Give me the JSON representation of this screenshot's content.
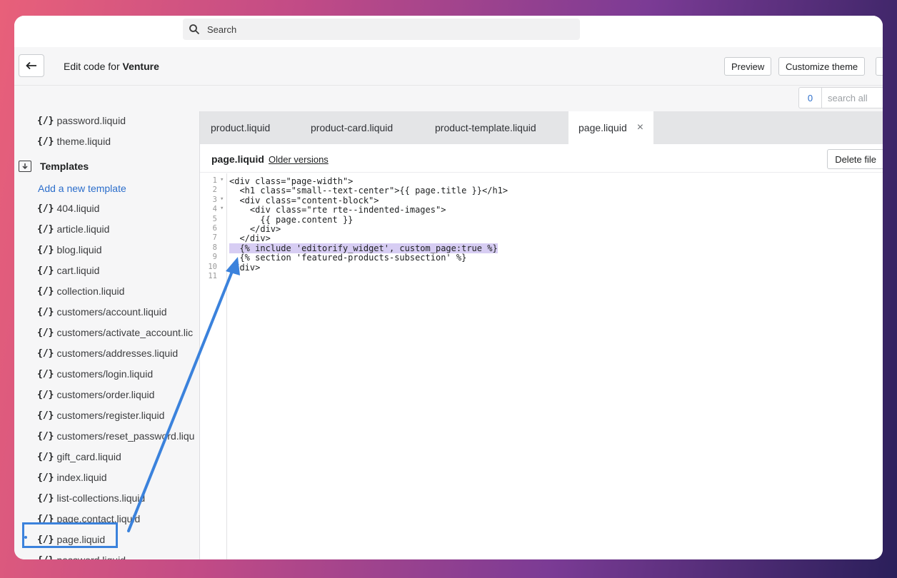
{
  "search": {
    "placeholder": "Search"
  },
  "header": {
    "title_prefix": "Edit code for ",
    "theme_name": "Venture",
    "buttons": {
      "preview": "Preview",
      "customize": "Customize theme"
    }
  },
  "file_search": {
    "count": "0",
    "placeholder": "search all"
  },
  "sidebar": {
    "top_items": [
      "password.liquid",
      "theme.liquid"
    ],
    "folder": "Templates",
    "add_link": "Add a new template",
    "items": [
      "404.liquid",
      "article.liquid",
      "blog.liquid",
      "cart.liquid",
      "collection.liquid",
      "customers/account.liquid",
      "customers/activate_account.lic",
      "customers/addresses.liquid",
      "customers/login.liquid",
      "customers/order.liquid",
      "customers/register.liquid",
      "customers/reset_password.liqu",
      "gift_card.liquid",
      "index.liquid",
      "list-collections.liquid",
      "page.contact.liquid",
      "page.liquid",
      "password.liquid"
    ],
    "icon_glyph": "{/}"
  },
  "tabs": [
    {
      "label": "product.liquid"
    },
    {
      "label": "product-card.liquid"
    },
    {
      "label": "product-template.liquid"
    },
    {
      "label": "page.liquid",
      "close": "×"
    }
  ],
  "editor": {
    "file_name": "page.liquid",
    "older_versions": "Older versions",
    "delete_label": "Delete file",
    "line_numbers": [
      "1",
      "2",
      "3",
      "4",
      "5",
      "6",
      "7",
      "8",
      "9",
      "10",
      "11"
    ],
    "lines": [
      "<div class=\"page-width\">",
      "  <h1 class=\"small--text-center\">{{ page.title }}</h1>",
      "  <div class=\"content-block\">",
      "    <div class=\"rte rte--indented-images\">",
      "      {{ page.content }}",
      "    </div>",
      "  </div>",
      "  {% include 'editorify_widget', custom_page:true %}",
      "  {% section 'featured-products-subsection' %}",
      "</div>",
      ""
    ],
    "highlighted_line": "8"
  },
  "colors": {
    "accent": "#3b82dc",
    "highlight": "#d7cdf3",
    "link": "#2c6ecb"
  }
}
